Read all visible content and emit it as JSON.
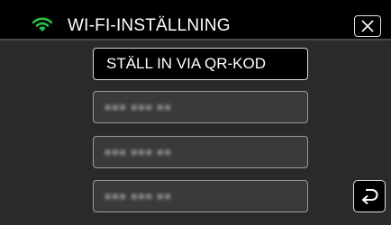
{
  "header": {
    "title": "WI-FI-INSTÄLLNING",
    "wifi_icon": "wifi-icon",
    "close_icon": "close-icon"
  },
  "menu": {
    "items": [
      {
        "label": "STÄLL IN VIA QR-KOD"
      },
      {
        "label": "■■■ ■■■ ■■"
      },
      {
        "label": "■■■ ■■■ ■■"
      },
      {
        "label": "■■■ ■■■ ■■"
      }
    ]
  },
  "footer": {
    "back_icon": "return-arrow-icon"
  },
  "colors": {
    "accent_wifi": "#2bc24a",
    "background": "#000000",
    "panel": "#2a2a2a"
  }
}
